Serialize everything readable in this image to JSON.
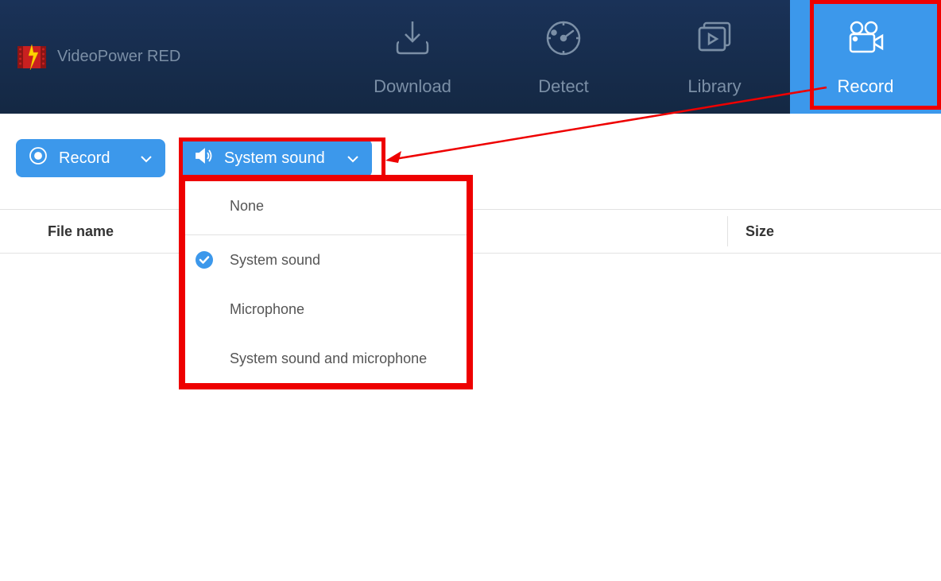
{
  "app": {
    "title": "VideoPower RED"
  },
  "nav": {
    "download": "Download",
    "detect": "Detect",
    "library": "Library",
    "record": "Record"
  },
  "toolbar": {
    "record_label": "Record",
    "sound_label": "System sound"
  },
  "table": {
    "col_filename": "File name",
    "col_size": "Size"
  },
  "dropdown": {
    "options": [
      "None",
      "System sound",
      "Microphone",
      "System sound and microphone"
    ],
    "selected_index": 1
  }
}
